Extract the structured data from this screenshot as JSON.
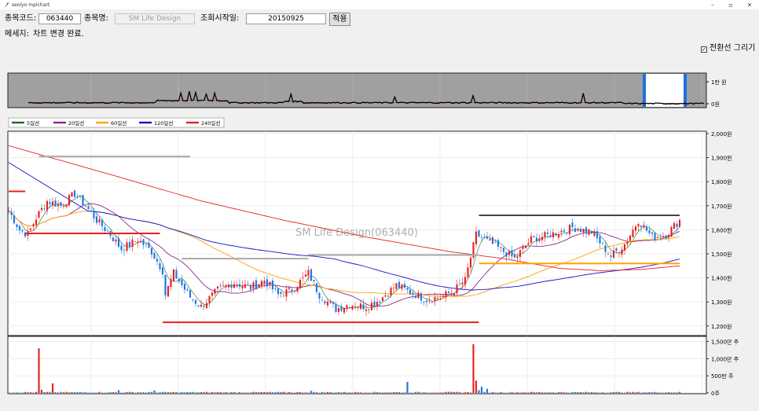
{
  "window": {
    "title": "seolyo mplchart"
  },
  "controls": {
    "code_label": "종목코드:",
    "code_value": "063440",
    "name_label": "종목명:",
    "name_value": "SM Life Design",
    "start_label": "조회시작일:",
    "start_value": "20150925",
    "apply_label": "적용",
    "message_label": "메세지:",
    "message_text": "차트 변경 완료.",
    "turn_line_label": "전환선 그리기",
    "turn_line_checked": true
  },
  "chart_data": {
    "type": "candlestick",
    "watermark": "SM Life Design(063440)",
    "legend": [
      "5일선",
      "20일선",
      "60일선",
      "120일선",
      "240일선"
    ],
    "legend_colors": [
      "#1e6b1e",
      "#8b2a8b",
      "#ffa500",
      "#1010c8",
      "#e82020"
    ],
    "price_ticks": [
      "2,000원",
      "1,900원",
      "1,800원",
      "1,700원",
      "1,600원",
      "1,500원",
      "1,400원",
      "1,300원",
      "1,200원"
    ],
    "price_tick_values": [
      2000,
      1900,
      1800,
      1700,
      1600,
      1500,
      1400,
      1300,
      1200
    ],
    "price_ylim": [
      1160,
      2010
    ],
    "volume_ticks": [
      "1,500만 주",
      "1,000만 주",
      "500만 주",
      "0주"
    ],
    "volume_tick_values": [
      15000000,
      10000000,
      5000000,
      0
    ],
    "volume_ylim": [
      0,
      16500000
    ],
    "overview_ticks": [
      "1만 원",
      "0원"
    ],
    "close_anchors": [
      [
        0,
        1680
      ],
      [
        4,
        1600
      ],
      [
        7,
        1580
      ],
      [
        10,
        1650
      ],
      [
        14,
        1720
      ],
      [
        19,
        1700
      ],
      [
        24,
        1750
      ],
      [
        28,
        1700
      ],
      [
        32,
        1640
      ],
      [
        37,
        1580
      ],
      [
        41,
        1520
      ],
      [
        47,
        1560
      ],
      [
        52,
        1510
      ],
      [
        56,
        1430
      ],
      [
        57,
        1330
      ],
      [
        60,
        1420
      ],
      [
        66,
        1320
      ],
      [
        70,
        1280
      ],
      [
        76,
        1350
      ],
      [
        82,
        1380
      ],
      [
        88,
        1360
      ],
      [
        93,
        1390
      ],
      [
        98,
        1330
      ],
      [
        103,
        1350
      ],
      [
        109,
        1420
      ],
      [
        113,
        1330
      ],
      [
        119,
        1270
      ],
      [
        124,
        1290
      ],
      [
        130,
        1280
      ],
      [
        135,
        1310
      ],
      [
        141,
        1370
      ],
      [
        146,
        1340
      ],
      [
        152,
        1310
      ],
      [
        157,
        1320
      ],
      [
        161,
        1340
      ],
      [
        166,
        1390
      ],
      [
        170,
        1580
      ],
      [
        176,
        1540
      ],
      [
        184,
        1480
      ],
      [
        190,
        1560
      ],
      [
        197,
        1580
      ],
      [
        205,
        1610
      ],
      [
        212,
        1590
      ],
      [
        219,
        1490
      ],
      [
        224,
        1540
      ],
      [
        229,
        1640
      ],
      [
        234,
        1570
      ],
      [
        239,
        1580
      ],
      [
        244,
        1640
      ]
    ],
    "volume_spikes": [
      [
        11,
        13000000
      ],
      [
        16,
        2800000
      ],
      [
        12,
        900000
      ],
      [
        40,
        800000
      ],
      [
        53,
        700000
      ],
      [
        145,
        3200000
      ],
      [
        169,
        14200000
      ],
      [
        170,
        3600000
      ],
      [
        171,
        800000
      ],
      [
        172,
        1800000
      ],
      [
        174,
        1200000
      ],
      [
        110,
        600000
      ]
    ],
    "ma_periods": [
      5,
      20,
      60,
      120,
      240
    ],
    "ma240": [
      [
        0,
        1950
      ],
      [
        40,
        1820
      ],
      [
        70,
        1720
      ],
      [
        100,
        1640
      ],
      [
        130,
        1570
      ],
      [
        160,
        1510
      ],
      [
        180,
        1480
      ],
      [
        200,
        1440
      ],
      [
        215,
        1430
      ],
      [
        230,
        1435
      ],
      [
        244,
        1450
      ]
    ],
    "levels": [
      {
        "from": 11,
        "to": 66,
        "price": 1905,
        "color": "#aaaaaa"
      },
      {
        "from": 0,
        "to": 6,
        "price": 1760,
        "color": "#e82020"
      },
      {
        "from": 6,
        "to": 55,
        "price": 1585,
        "color": "#e82020"
      },
      {
        "from": 63,
        "to": 109,
        "price": 1480,
        "color": "#aaaaaa"
      },
      {
        "from": 109,
        "to": 171,
        "price": 1495,
        "color": "#aaaaaa"
      },
      {
        "from": 171,
        "to": 244,
        "price": 1660,
        "color": "#444444"
      },
      {
        "from": 171,
        "to": 244,
        "price": 1460,
        "color": "#ffa500"
      },
      {
        "from": 56,
        "to": 171,
        "price": 1215,
        "color": "#e82020"
      }
    ],
    "up_color": "#e82020",
    "down_color": "#1a78e8"
  }
}
